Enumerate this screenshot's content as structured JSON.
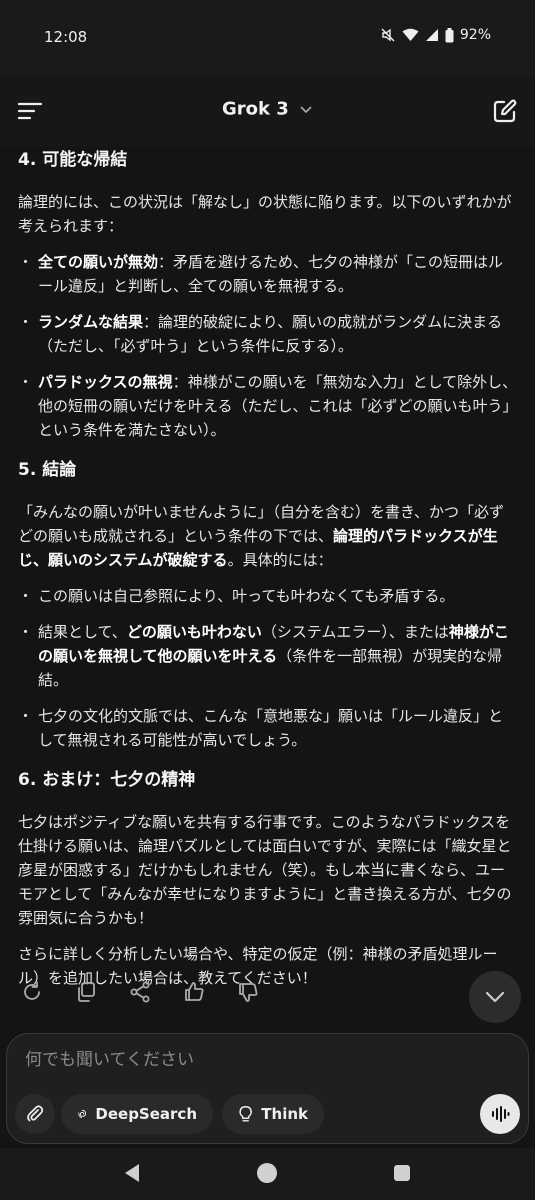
{
  "status": {
    "time": "12:08",
    "battery": "92%"
  },
  "header": {
    "title": "Grok 3"
  },
  "sections": {
    "s4": {
      "heading": "4. 可能な帰結",
      "intro": "論理的には、この状況は「解なし」の状態に陥ります。以下のいずれかが考えられます：",
      "b1_bold": "全ての願いが無効",
      "b1_text": "：矛盾を避けるため、七夕の神様が「この短冊はルール違反」と判断し、全ての願いを無視する。",
      "b2_bold": "ランダムな結果",
      "b2_text": "：論理的破綻により、願いの成就がランダムに決まる（ただし、「必ず叶う」という条件に反する）。",
      "b3_bold": "パラドックスの無視",
      "b3_text": "：神様がこの願いを「無効な入力」として除外し、他の短冊の願いだけを叶える（ただし、これは「必ずどの願いも叶う」という条件を満たさない）。"
    },
    "s5": {
      "heading": "5. 結論",
      "p1_a": "「みんなの願いが叶いませんように」（自分を含む）を書き、かつ「必ずどの願いも成就される」という条件の下では、",
      "p1_bold": "論理的パラドックスが生じ、願いのシステムが破綻する",
      "p1_b": "。具体的には：",
      "b1": "この願いは自己参照により、叶っても叶わなくても矛盾する。",
      "b2_a": "結果として、",
      "b2_bold1": "どの願いも叶わない",
      "b2_b": "（システムエラー）、または",
      "b2_bold2": "神様がこの願いを無視して他の願いを叶える",
      "b2_c": "（条件を一部無視）が現実的な帰結。",
      "b3": "七夕の文化的文脈では、こんな「意地悪な」願いは「ルール違反」として無視される可能性が高いでしょう。"
    },
    "s6": {
      "heading": "6. おまけ：七夕の精神",
      "p1": "七夕はポジティブな願いを共有する行事です。このようなパラドックスを仕掛ける願いは、論理パズルとしては面白いですが、実際には「織女星と彦星が困惑する」だけかもしれません（笑）。もし本当に書くなら、ユーモアとして「みんなが幸せになりますように」と書き換える方が、七夕の雰囲気に合うかも！",
      "p2": "さらに詳しく分析したい場合や、特定の仮定（例：神様の矛盾処理ルール）を追加したい場合は、教えてください！"
    }
  },
  "actions": [
    "refresh-icon",
    "copy-icon",
    "share-icon",
    "thumbs-up-icon",
    "thumbs-down-icon"
  ],
  "composer": {
    "placeholder": "何でも聞いてください",
    "deepsearch_label": "DeepSearch",
    "think_label": "Think"
  }
}
